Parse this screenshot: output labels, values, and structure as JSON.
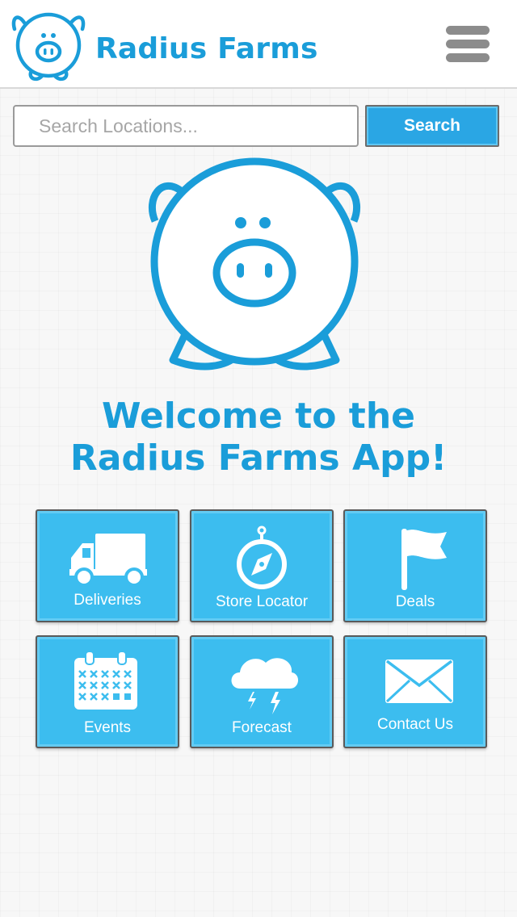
{
  "header": {
    "brand": "Radius Farms",
    "logo_icon": "pig-face-icon",
    "menu_icon": "hamburger-menu-icon"
  },
  "search": {
    "placeholder": "Search Locations...",
    "value": "",
    "button_label": "Search"
  },
  "hero": {
    "icon": "piggy-icon",
    "welcome_line1": "Welcome to the",
    "welcome_line2": "Radius Farms App!"
  },
  "tiles": [
    {
      "label": "Deliveries",
      "icon": "truck-icon"
    },
    {
      "label": "Store Locator",
      "icon": "compass-icon"
    },
    {
      "label": "Deals",
      "icon": "flag-icon"
    },
    {
      "label": "Events",
      "icon": "calendar-icon"
    },
    {
      "label": "Forecast",
      "icon": "storm-cloud-icon"
    },
    {
      "label": "Contact Us",
      "icon": "envelope-icon"
    }
  ],
  "colors": {
    "brand_blue": "#1a9dd9",
    "tile_blue": "#3cbdef",
    "button_blue": "#2aa6e4",
    "menu_gray": "#8c8c8c"
  }
}
